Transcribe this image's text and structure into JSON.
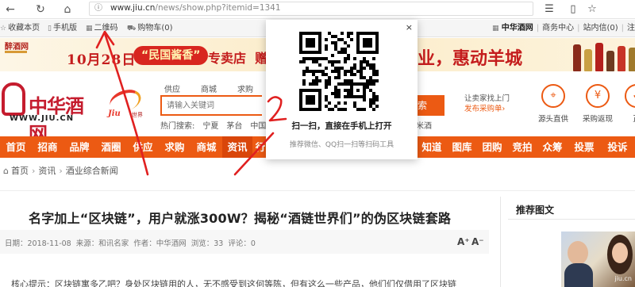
{
  "browser": {
    "url_host": "www.jiu.cn",
    "url_path": "/news/show.php?itemid=1341",
    "icons": [
      "back-icon",
      "refresh-icon",
      "home-icon",
      "info-icon",
      "favorites-icon",
      "reading-icon",
      "star-icon"
    ]
  },
  "topbar": {
    "favorite": "收藏本页",
    "mobile": "手机版",
    "qrcode": "二维码",
    "cart": "购物车(0)",
    "brand": "中华酒网",
    "merchant": "商务中心",
    "sitemsg": "站内信(0)",
    "cut": "注"
  },
  "banner": {
    "logo": "醉酒网",
    "date": "10月28日",
    "pill": "“民国酱香”",
    "shop": "专卖店",
    "gift": "赠",
    "tail": "业，惠动羊城"
  },
  "header": {
    "logo_title": "中华酒网",
    "logo_url": "WWW.JIU.CN",
    "jiu_text": "Jiu",
    "jiu_sub": "世界",
    "search_tabs": [
      "供应",
      "商城",
      "求购"
    ],
    "search_placeholder": "请输入关键词",
    "search_button": "搜索",
    "hot_label": "热门搜索:",
    "hot_words": [
      "宁夏",
      "茅台",
      "中国"
    ],
    "hot_extra": "米酒",
    "promo_line1": "让卖家找上门",
    "promo_line2": "发布采购单›",
    "services": [
      {
        "label": "源头直供",
        "icon": "location-icon"
      },
      {
        "label": "采购返现",
        "icon": "cashback-icon"
      },
      {
        "label": "正",
        "icon": "shield-icon"
      }
    ]
  },
  "nav": {
    "left": [
      "首页",
      "招商",
      "品牌",
      "酒圈",
      "供应",
      "求购",
      "商城",
      "资讯",
      "行"
    ],
    "right": [
      "知道",
      "图库",
      "团购",
      "竞拍",
      "众筹",
      "投票",
      "投诉"
    ],
    "active": "资讯"
  },
  "breadcrumb": [
    "首页",
    "资讯",
    "酒业综合新闻"
  ],
  "article": {
    "title": "名字加上“区块链”，用户就涨300W？揭秘“酒链世界们”的伪区块链套路",
    "date": "日期：2018-11-08",
    "source": "来源：和讯名家",
    "author": "作者：中华酒网",
    "views": "浏览：33",
    "comments": "评论：0",
    "font_bigger": "A⁺",
    "font_smaller": "A⁻",
    "summary": "核心提示：区块链寓多乙吧？身处区块链用的人，无不感受到这何等陈，但有这么一些产品，他们们仅借用了区块链"
  },
  "sidebar": {
    "title": "推荐图文",
    "image_tag": "jiu.cn"
  },
  "modal": {
    "close": "×",
    "heading": "扫一扫，直接在手机上打开",
    "subtext": "推荐微信、QQ扫一扫等扫码工具"
  },
  "colors": {
    "accent": "#ec5a13",
    "brand_red": "#c51c2e",
    "annotation": "#e02020"
  }
}
